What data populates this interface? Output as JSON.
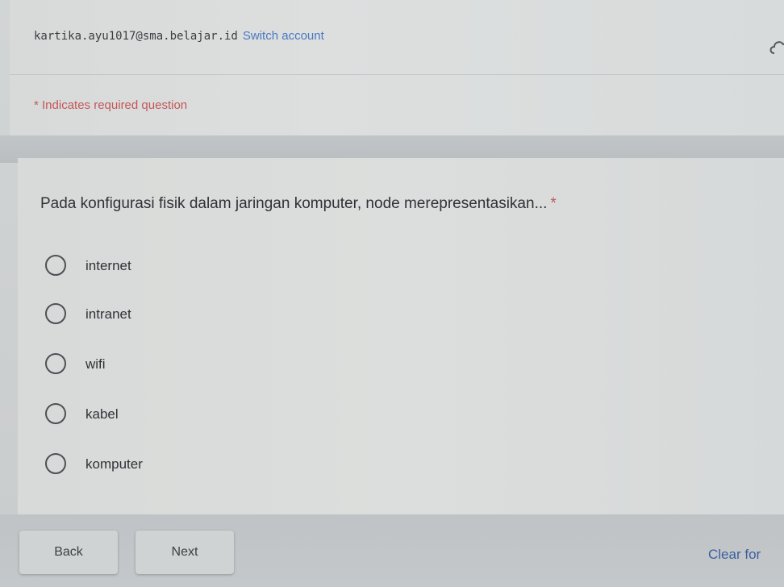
{
  "account": {
    "email": "kartika.ayu1017@sma.belajar.id",
    "switch_label": "Switch account"
  },
  "form": {
    "required_note": "* Indicates required question"
  },
  "question": {
    "text": "Pada konfigurasi fisik dalam jaringan komputer, node merepresentasikan...",
    "required_marker": "*",
    "options": [
      {
        "label": "internet",
        "selected": false
      },
      {
        "label": "intranet",
        "selected": false
      },
      {
        "label": "wifi",
        "selected": false
      },
      {
        "label": "kabel",
        "selected": false
      },
      {
        "label": "komputer",
        "selected": false
      }
    ]
  },
  "navigation": {
    "back_label": "Back",
    "next_label": "Next",
    "clear_label": "Clear for"
  },
  "icons": {
    "header_right": "cloud-icon"
  },
  "colors": {
    "link": "#4a78c2",
    "required": "#c4565a"
  }
}
